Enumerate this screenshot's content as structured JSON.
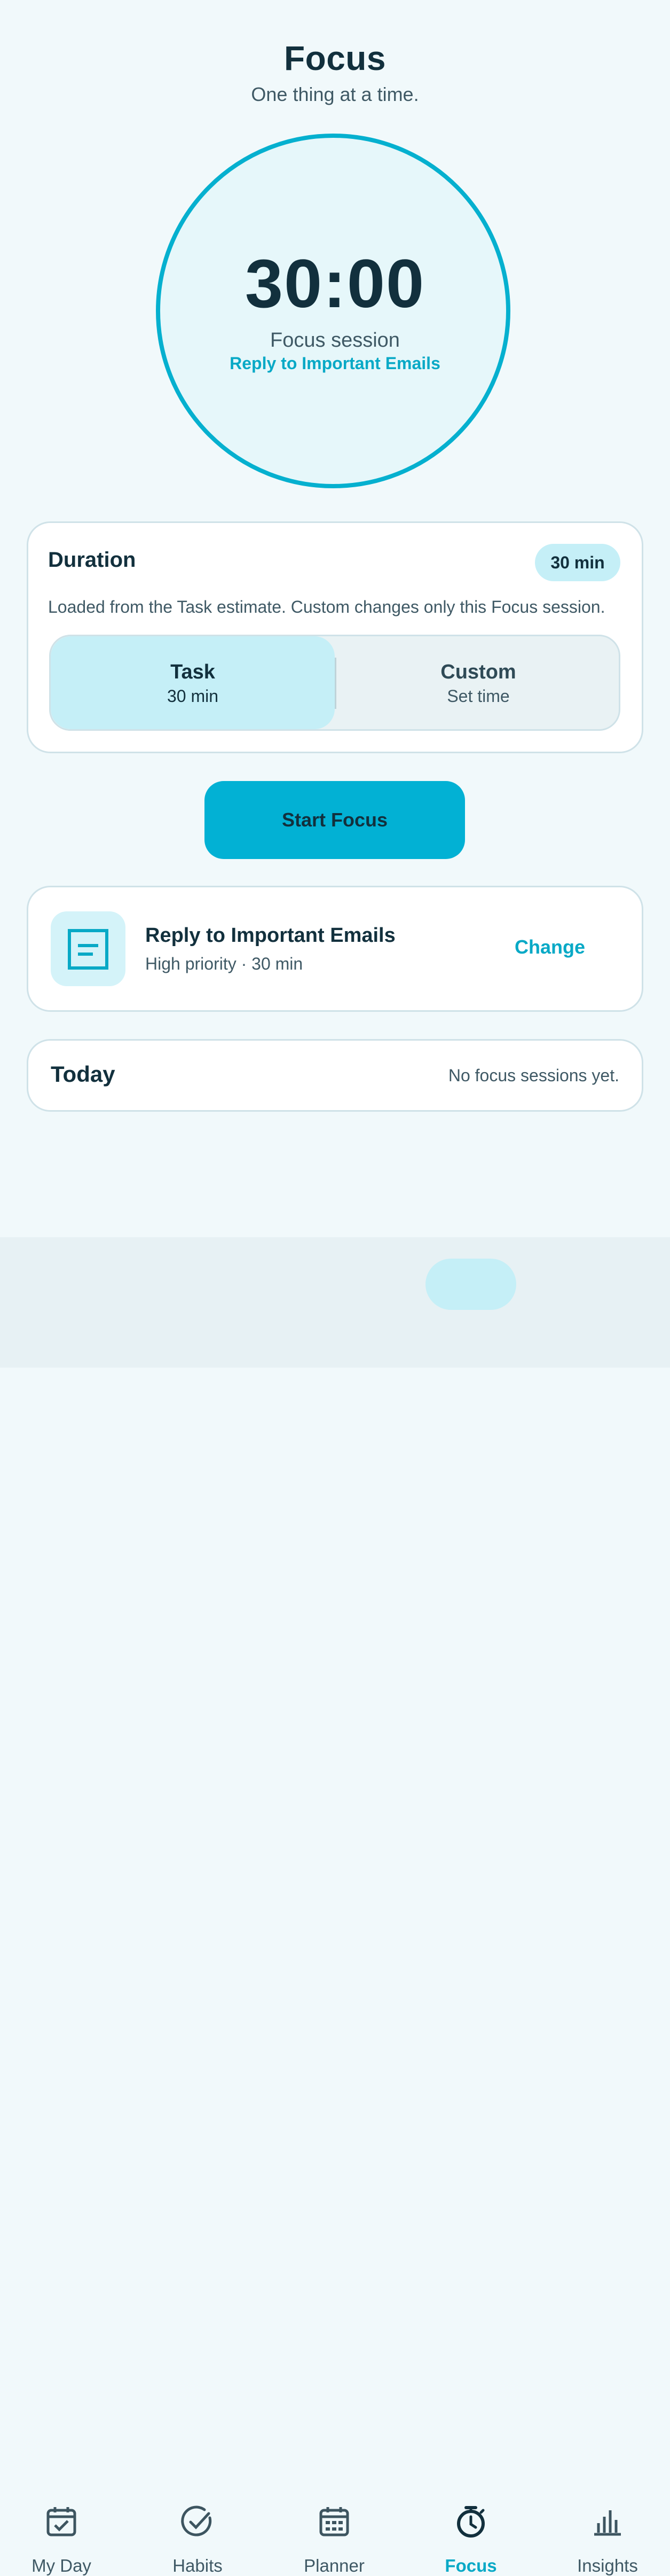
{
  "header": {
    "title": "Focus",
    "subtitle": "One thing at a time."
  },
  "timer": {
    "time": "30:00",
    "label": "Focus session",
    "task_name": "Reply to Important Emails",
    "ring_color": "#05b0cf"
  },
  "duration": {
    "title": "Duration",
    "badge": "30 min",
    "description": "Loaded from the Task estimate. Custom changes only this Focus session.",
    "options": [
      {
        "label": "Task",
        "sub": "30 min",
        "selected": true
      },
      {
        "label": "Custom",
        "sub": "Set time",
        "selected": false
      }
    ]
  },
  "start_button": {
    "label": "Start Focus",
    "color": "#02b1d4"
  },
  "task_card": {
    "icon": "document-icon",
    "title": "Reply to Important Emails",
    "meta": "High priority · 30 min",
    "action": "Change"
  },
  "today": {
    "title": "Today",
    "empty_text": "No focus sessions yet."
  },
  "nav": {
    "active": "Focus",
    "accent": "#08a9c6",
    "items": [
      {
        "label": "My Day",
        "icon": "calendar-check-icon"
      },
      {
        "label": "Habits",
        "icon": "check-circle-icon"
      },
      {
        "label": "Planner",
        "icon": "calendar-grid-icon"
      },
      {
        "label": "Focus",
        "icon": "stopwatch-icon"
      },
      {
        "label": "Insights",
        "icon": "bar-chart-icon"
      }
    ]
  }
}
